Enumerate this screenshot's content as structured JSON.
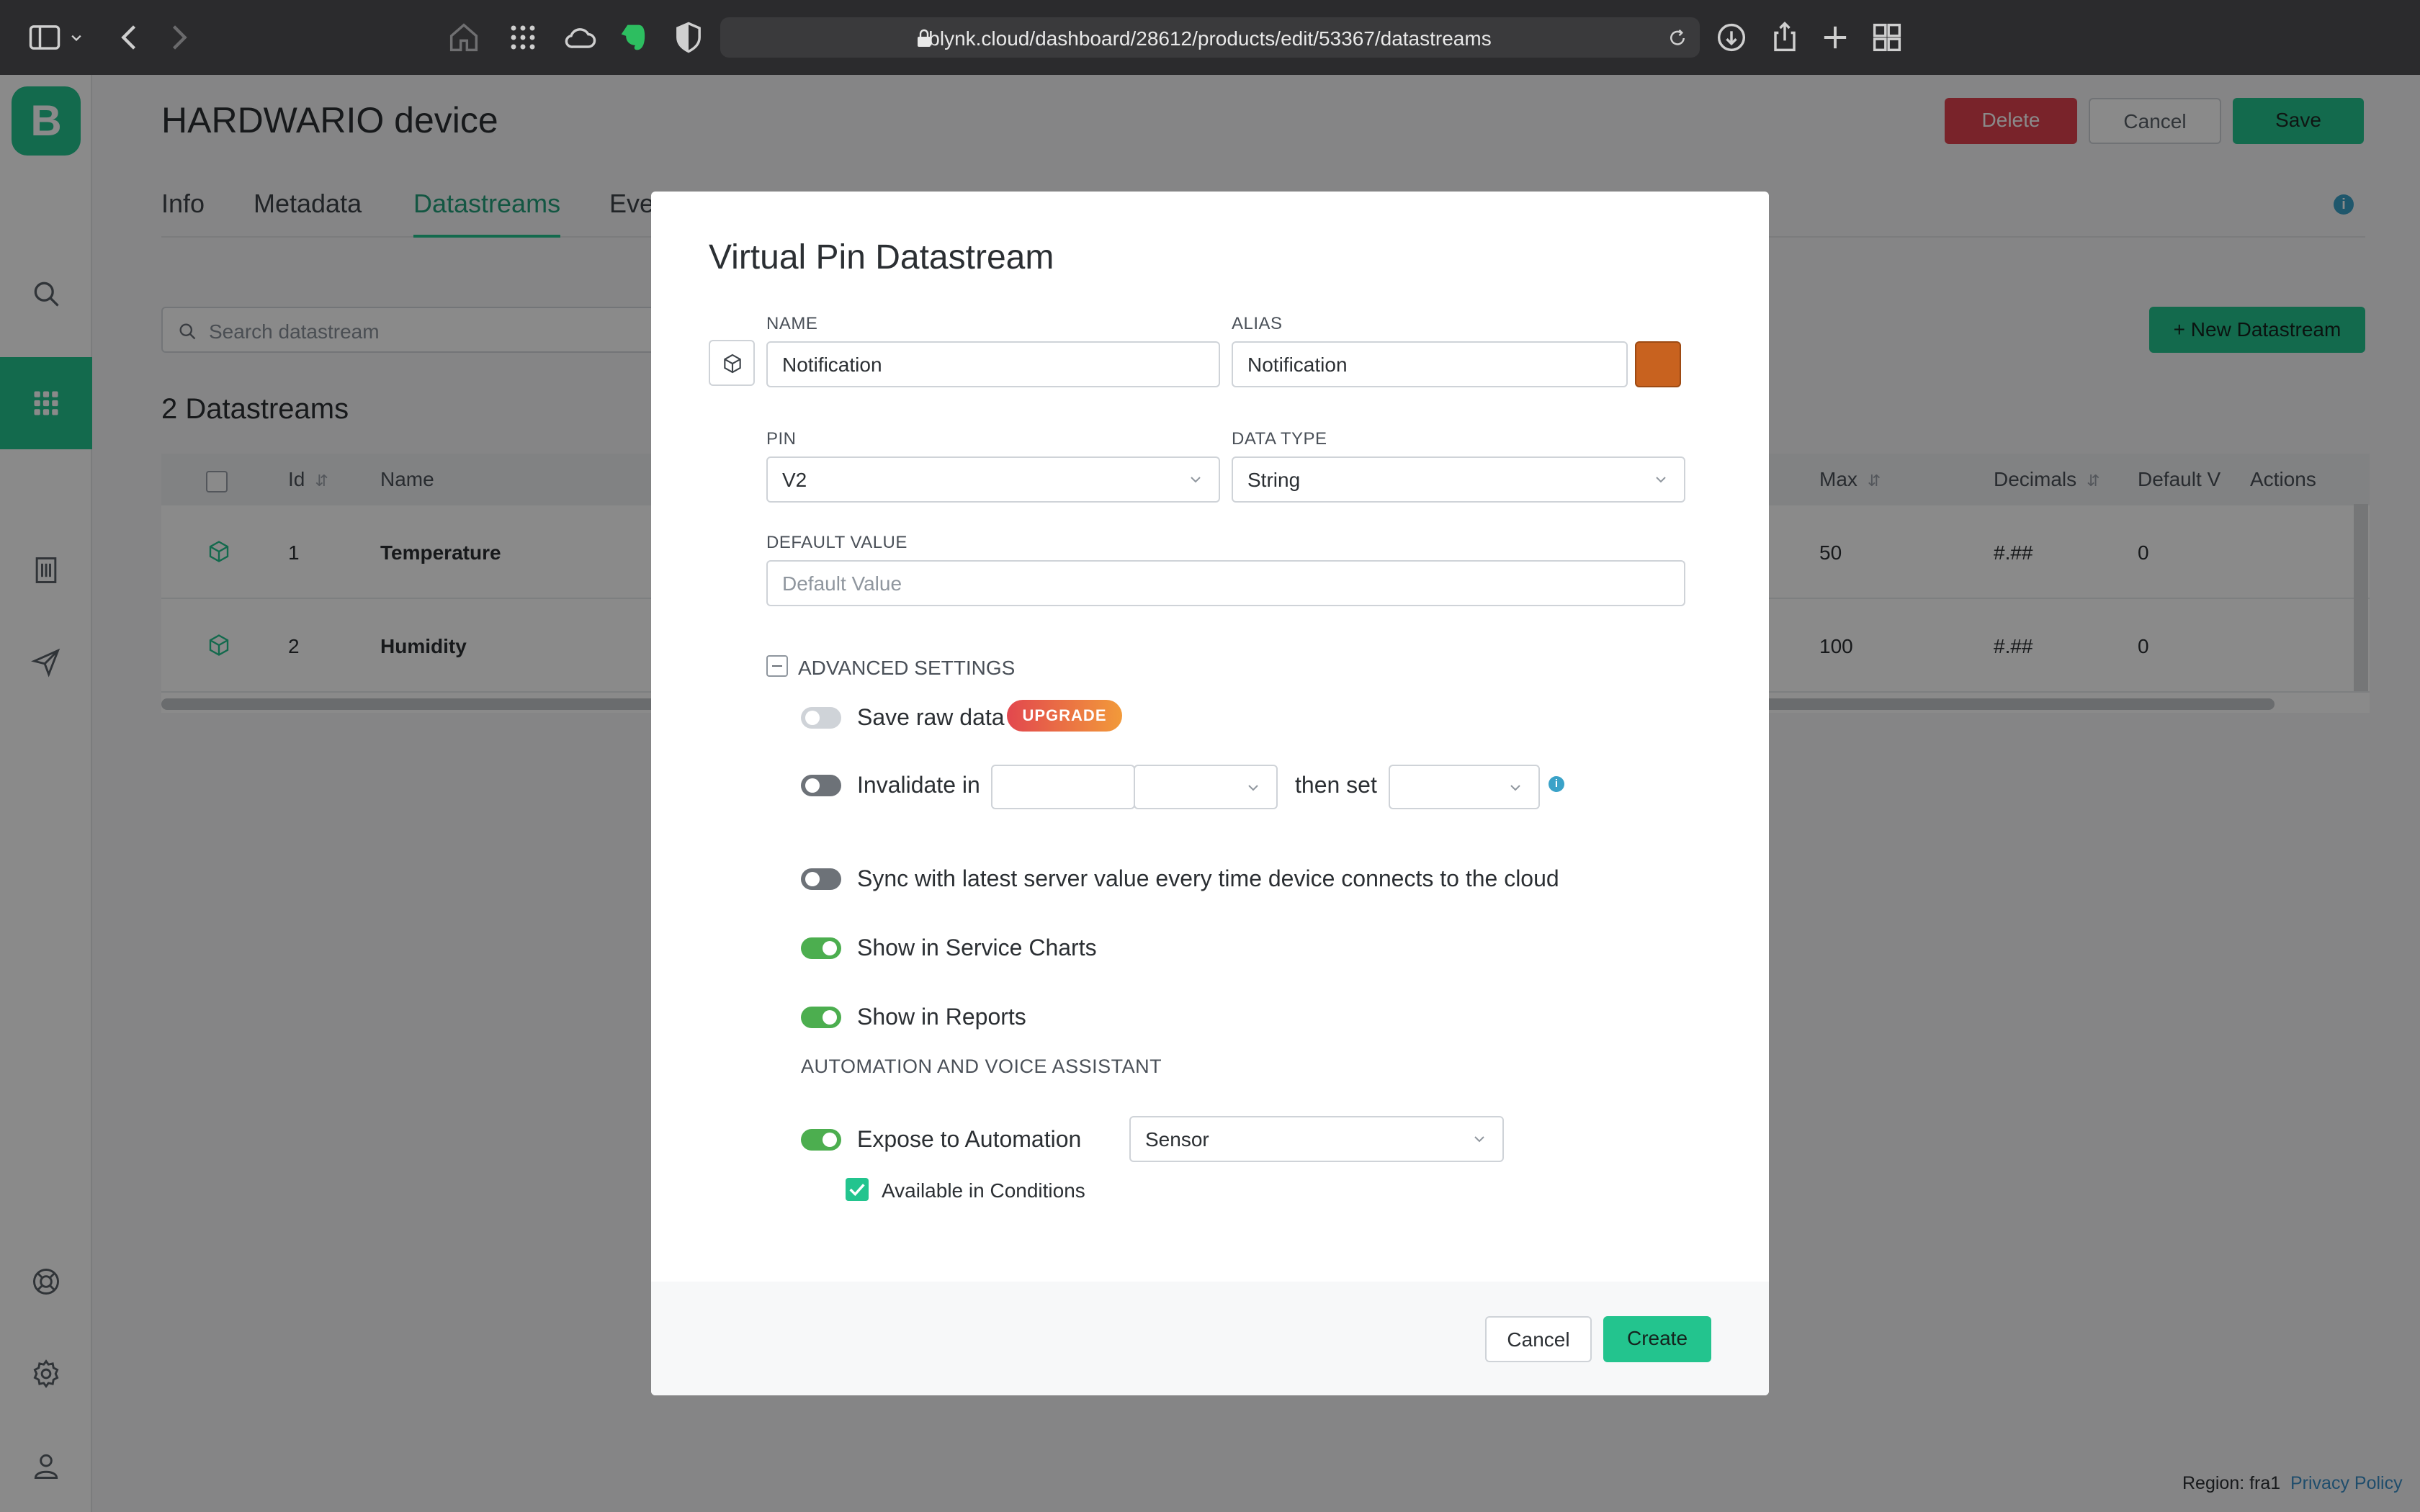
{
  "browser": {
    "url": "blynk.cloud/dashboard/28612/products/edit/53367/datastreams"
  },
  "app": {
    "logo_letter": "B",
    "brand_color": "#23c48e"
  },
  "page": {
    "title": "HARDWARIO device",
    "buttons": {
      "delete": "Delete",
      "cancel": "Cancel",
      "save": "Save"
    },
    "tabs": [
      "Info",
      "Metadata",
      "Datastreams",
      "Eve"
    ],
    "active_tab": "Datastreams",
    "search_placeholder": "Search datastream",
    "new_button": "+ New Datastream",
    "count_label": "2 Datastreams"
  },
  "table": {
    "columns": [
      "Id",
      "Name",
      "Max",
      "Decimals",
      "Default V",
      "Actions"
    ],
    "rows": [
      {
        "id": "1",
        "name": "Temperature",
        "max": "50",
        "decimals": "#.##",
        "default": "0"
      },
      {
        "id": "2",
        "name": "Humidity",
        "max": "100",
        "decimals": "#.##",
        "default": "0"
      }
    ]
  },
  "footer": {
    "region": "Region: fra1",
    "privacy": "Privacy Policy"
  },
  "modal": {
    "title": "Virtual Pin Datastream",
    "name_label": "NAME",
    "name_value": "Notification",
    "alias_label": "ALIAS",
    "alias_value": "Notification",
    "color": "#c8621f",
    "pin_label": "PIN",
    "pin_value": "V2",
    "datatype_label": "DATA TYPE",
    "datatype_value": "String",
    "default_label": "DEFAULT VALUE",
    "default_placeholder": "Default Value",
    "advanced_label": "ADVANCED SETTINGS",
    "save_raw_label": "Save raw data",
    "upgrade_badge": "UPGRADE",
    "invalidate_label": "Invalidate in",
    "then_set_label": "then set",
    "sync_label": "Sync with latest server value every time device connects to the cloud",
    "service_charts_label": "Show in Service Charts",
    "reports_label": "Show in Reports",
    "automation_section": "AUTOMATION AND VOICE ASSISTANT",
    "expose_label": "Expose to Automation",
    "expose_value": "Sensor",
    "conditions_label": "Available in Conditions",
    "toggles": {
      "save_raw": false,
      "invalidate": false,
      "sync": false,
      "service_charts": true,
      "reports": true,
      "expose": true
    },
    "conditions_checked": true,
    "cancel": "Cancel",
    "create": "Create"
  }
}
